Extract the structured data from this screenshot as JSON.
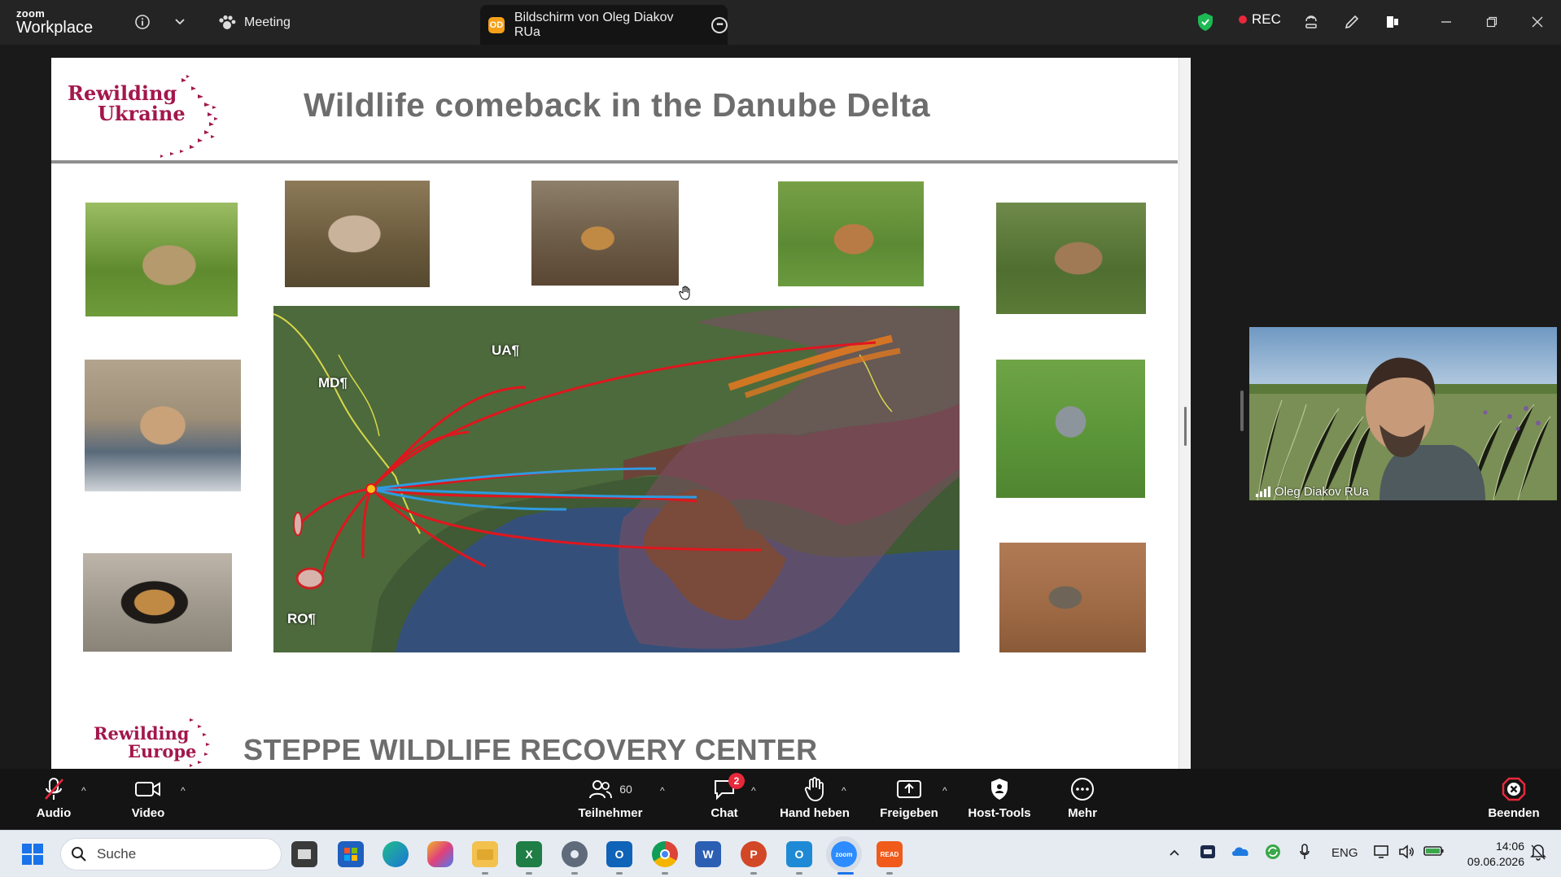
{
  "topbar": {
    "brand_small": "zoom",
    "brand_large": "Workplace",
    "meeting_tab": "Meeting",
    "share_tab_initials": "OD",
    "share_tab_label": "Bildschirm von Oleg Diakov RUa",
    "rec_label": "REC",
    "accent_green": "#1db954",
    "rec_color": "#e8283b"
  },
  "slide": {
    "logo_top": [
      "Rewilding",
      "Ukraine"
    ],
    "title": "Wildlife comeback in the Danube Delta",
    "map_labels": {
      "ua": "UA¶",
      "md": "MD¶",
      "ro": "RO¶"
    },
    "logo_bottom": [
      "Rewilding",
      "Europe"
    ],
    "footer_title": "STEPPE WILDLIFE RECOVERY CENTER"
  },
  "video": {
    "participant_name": "Oleg Diakov RUa"
  },
  "toolbar": {
    "audio": "Audio",
    "video": "Video",
    "participants": "Teilnehmer",
    "participants_count": "60",
    "chat": "Chat",
    "chat_badge": "2",
    "raise_hand": "Hand heben",
    "share": "Freigeben",
    "host_tools": "Host-Tools",
    "more": "Mehr",
    "end": "Beenden",
    "end_color": "#e8283b"
  },
  "taskbar": {
    "search_placeholder": "Suche",
    "language": "ENG",
    "time": "14:06",
    "date": "09.06.2026",
    "apps": [
      "file-explorer-icon",
      "store-icon",
      "edge-icon",
      "copilot-icon",
      "folder-icon",
      "excel-icon",
      "settings-icon",
      "outlook-icon",
      "chrome-icon",
      "word-icon",
      "powerpoint-icon",
      "outlook-new-icon",
      "zoom-icon",
      "reader-icon"
    ]
  }
}
